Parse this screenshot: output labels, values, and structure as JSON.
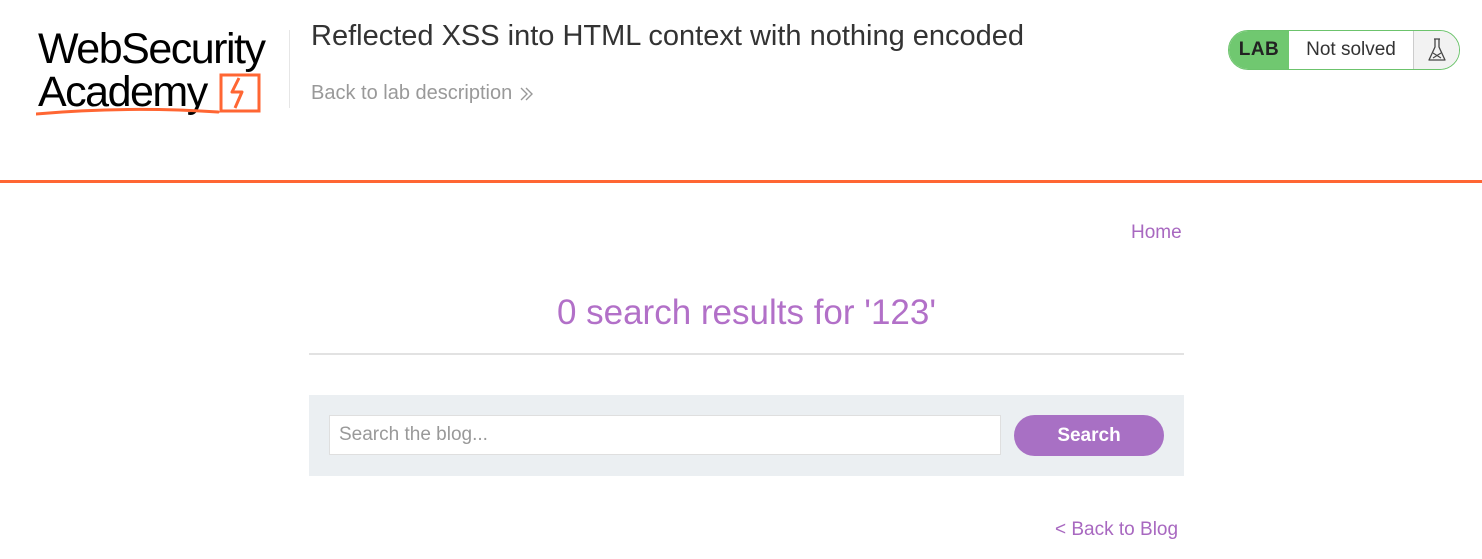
{
  "header": {
    "logo_line1": "WebSecurity",
    "logo_line2": "Academy",
    "title": "Reflected XSS into HTML context with nothing encoded",
    "back_to_description": "Back to lab description",
    "lab_badge": {
      "label": "LAB",
      "status": "Not solved",
      "icon": "flask-icon"
    },
    "accent_color": "#ff6633",
    "lab_color": "#70c870"
  },
  "nav": {
    "home": "Home"
  },
  "main": {
    "results_heading": "0 search results for '123'",
    "search": {
      "placeholder": "Search the blog...",
      "value": "",
      "button_label": "Search"
    },
    "back_to_blog": "< Back to Blog",
    "link_color": "#a868c0"
  }
}
